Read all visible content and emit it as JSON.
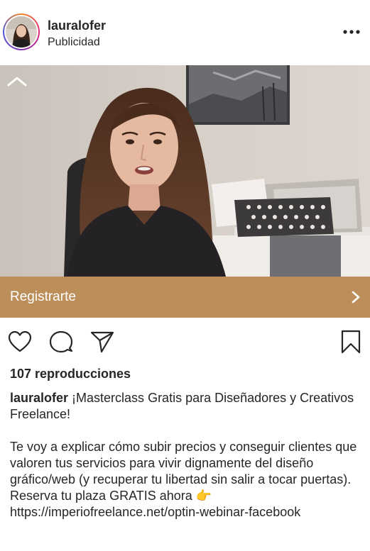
{
  "post": {
    "username": "lauralofer",
    "sponsored_label": "Publicidad",
    "more_icon": "more-horizontal-icon"
  },
  "cta": {
    "label": "Registrarte",
    "arrow_icon": "chevron-right-icon",
    "color": "#bc8f5a"
  },
  "actions": {
    "like_icon": "heart-icon",
    "comment_icon": "comment-icon",
    "share_icon": "paper-plane-icon",
    "save_icon": "bookmark-icon"
  },
  "stats": {
    "views": "107 reproducciones"
  },
  "caption": {
    "username": "lauralofer",
    "headline": "¡Masterclass Gratis para Diseñadores y Creativos Freelance!",
    "body": "Te voy a explicar cómo subir precios y conseguir clientes que valoren tus servicios para vivir dignamente del diseño gráfico/web (y recuperar tu libertad sin salir a tocar puertas). Reserva tu plaza GRATIS ahora",
    "pointing_emoji": "👉",
    "link": "https://imperiofreelance.net/optin-webinar-facebook"
  }
}
